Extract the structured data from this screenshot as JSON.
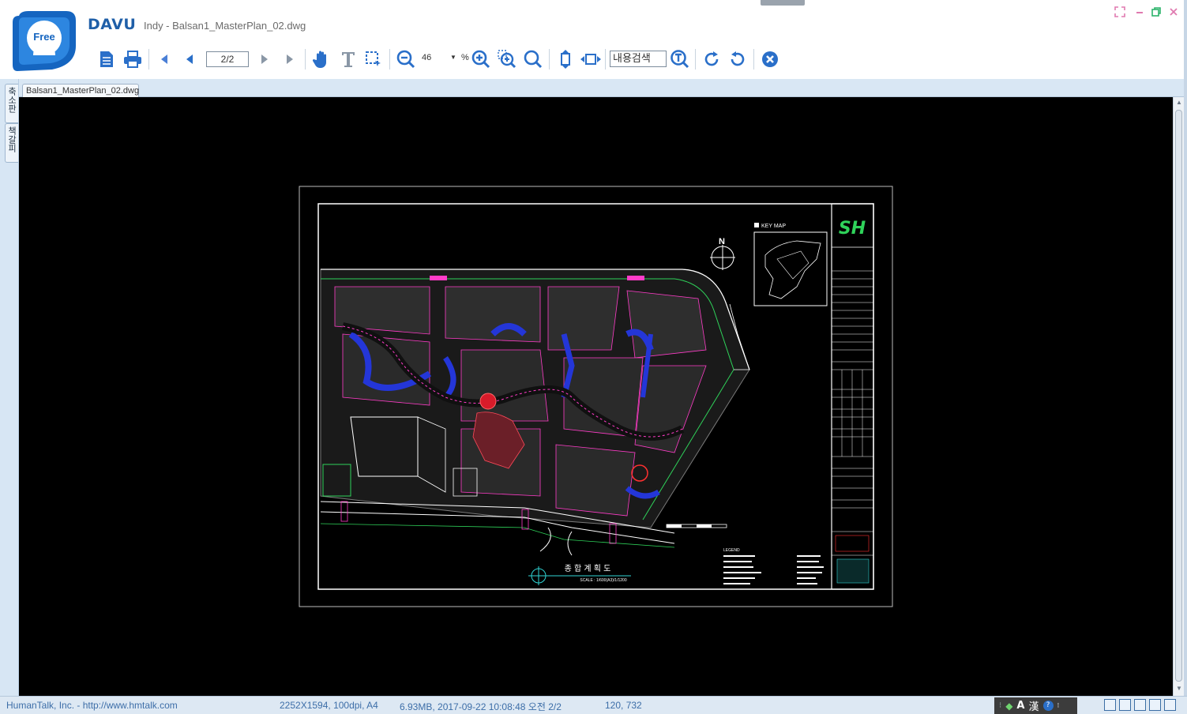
{
  "window": {
    "brand": "DAVU",
    "title": "Indy - Balsan1_MasterPlan_02.dwg",
    "logo_text": "Free"
  },
  "toolbar": {
    "page_value": "2/2",
    "zoom_value": "46",
    "zoom_unit": "%",
    "search_placeholder": "내용검색"
  },
  "side_tabs": [
    {
      "label": "축소판"
    },
    {
      "label": "책갈피"
    }
  ],
  "tabs": [
    {
      "label": "Balsan1_MasterPlan_02.dwg"
    }
  ],
  "drawing": {
    "key_map_label": "KEY MAP",
    "north_label": "N",
    "sheet_title": "종 합 계 획 도",
    "scale_text": "SCALE : 1/600(A3)/1/1200",
    "logo_text": "SH",
    "legend_label": "LEGEND"
  },
  "status": {
    "company": "HumanTalk, Inc. - http://www.hmtalk.com",
    "image_info": "2252X1594, 100dpi, A4",
    "file_info": "6.93MB, 2017-09-22 10:08:48 오전 2/2",
    "coords": "120, 732",
    "ime_lang": "A",
    "ime_hanja": "漢"
  },
  "colors": {
    "accent": "#1f5fa8",
    "toolbar_icon": "#2a6fc9",
    "canvas": "#000000",
    "status_text": "#3d6ea8"
  },
  "icons": [
    "document-icon",
    "print-icon",
    "first-page-icon",
    "prev-page-icon",
    "next-page-icon",
    "last-page-icon",
    "hand-icon",
    "text-select-icon",
    "area-select-icon",
    "zoom-out-icon",
    "zoom-in-icon",
    "zoom-area-icon",
    "zoom-fit-icon",
    "fit-height-icon",
    "fit-width-icon",
    "search-text-icon",
    "rotate-cw-icon",
    "rotate-ccw-icon",
    "close-doc-icon"
  ]
}
